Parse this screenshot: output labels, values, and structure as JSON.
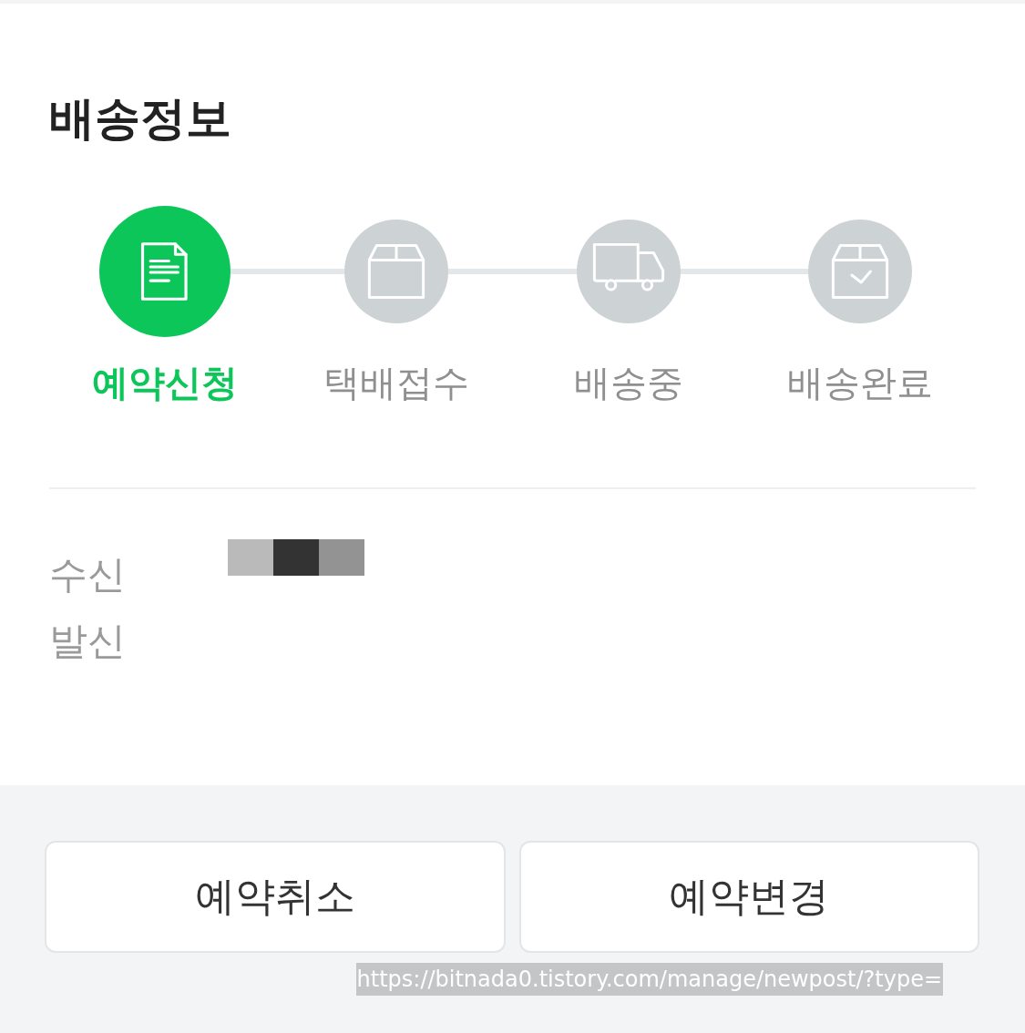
{
  "section": {
    "title": "배송정보"
  },
  "steps": [
    {
      "label": "예약신청",
      "kind": "document",
      "active": true
    },
    {
      "label": "택배접수",
      "kind": "box",
      "active": false
    },
    {
      "label": "배송중",
      "kind": "truck",
      "active": false
    },
    {
      "label": "배송완료",
      "kind": "delivered",
      "active": false
    }
  ],
  "details": [
    {
      "label": "수신",
      "redacted": true
    },
    {
      "label": "발신",
      "redacted": false
    }
  ],
  "buttons": [
    "예약취소",
    "예약변경"
  ],
  "link_preview": "https://bitnada0.tistory.com/manage/newpost/?type="
}
